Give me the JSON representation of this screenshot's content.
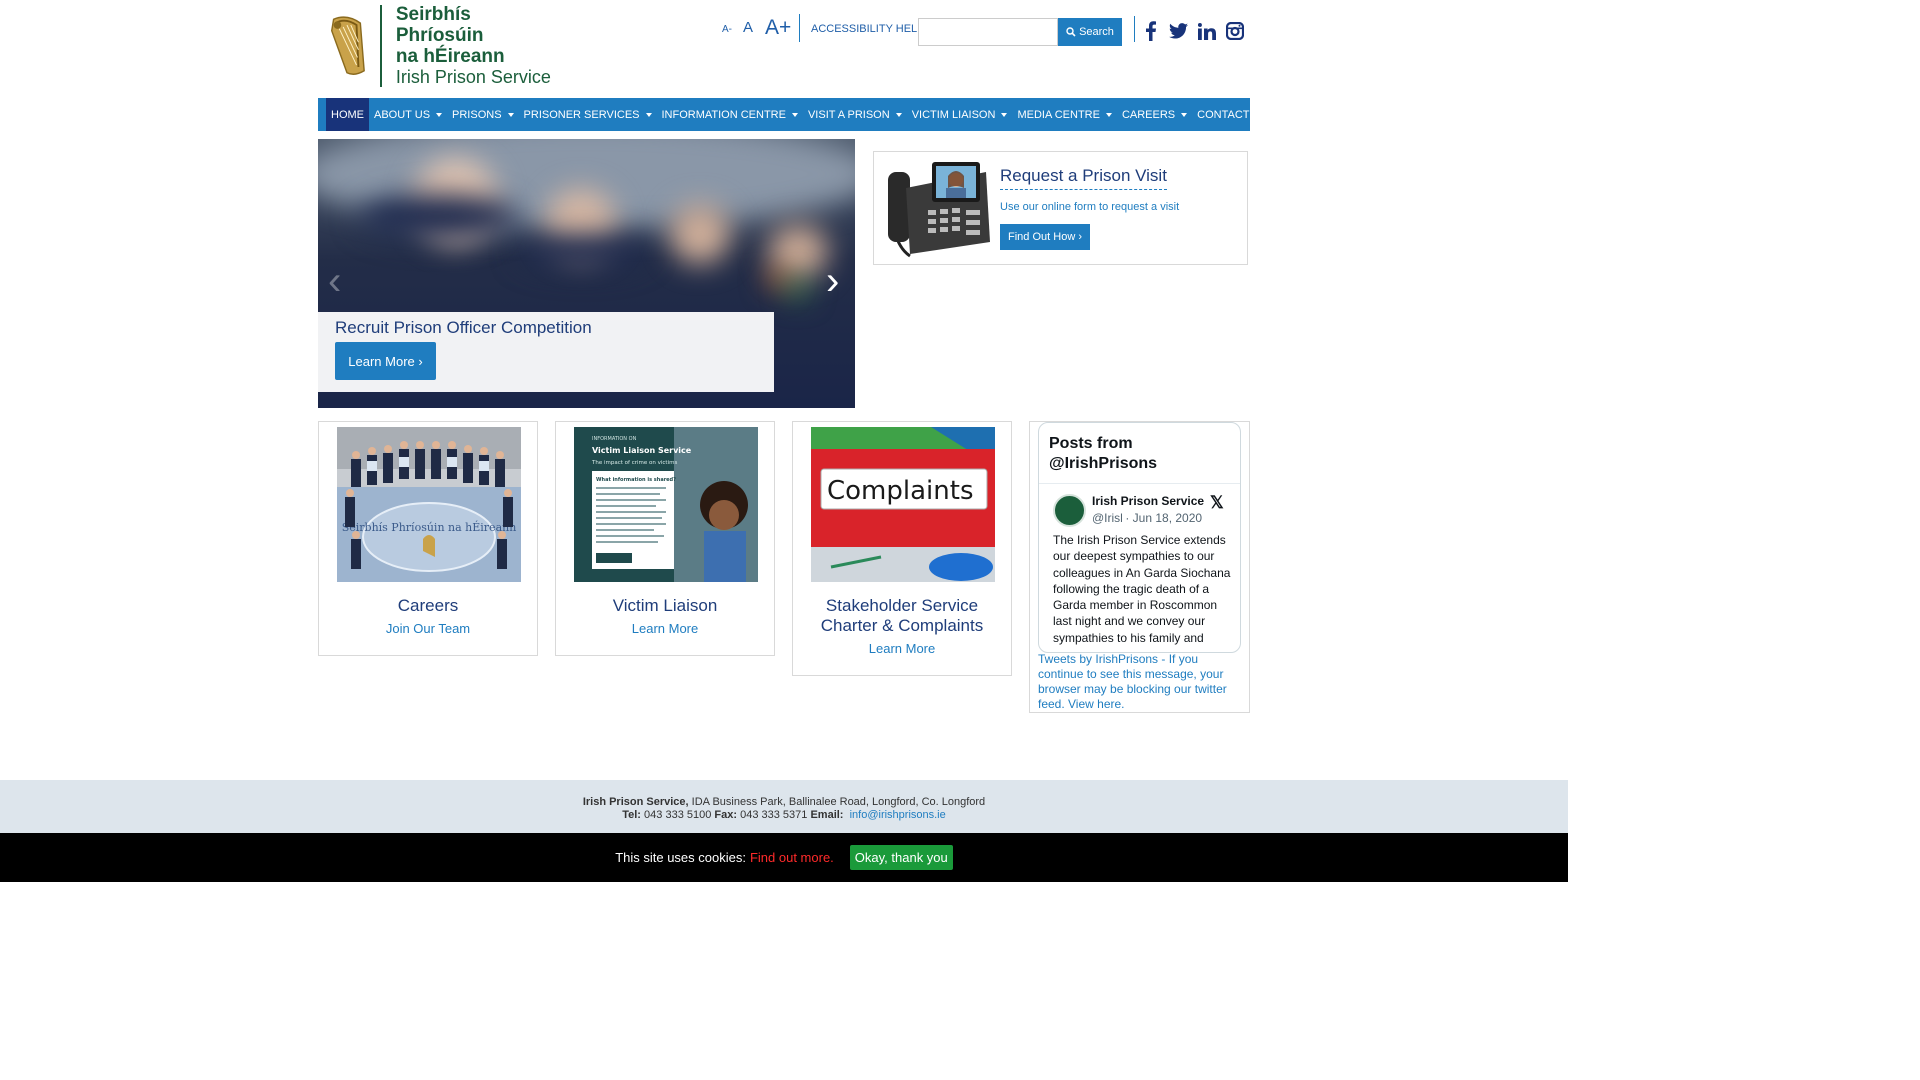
{
  "logo": {
    "line1": "Seirbhís Phríosúin",
    "line2": "na hÉireann",
    "line3": "Irish Prison Service"
  },
  "header": {
    "text_small": "A-",
    "text_medium": "A",
    "text_large": "A+",
    "accessibility_help": "ACCESSIBILITY HELP",
    "search_value": "",
    "search_button": "Search"
  },
  "nav": [
    {
      "label": "HOME",
      "active": true,
      "dropdown": false
    },
    {
      "label": "ABOUT US",
      "dropdown": true
    },
    {
      "label": "PRISONS",
      "dropdown": true
    },
    {
      "label": "PRISONER SERVICES",
      "dropdown": true
    },
    {
      "label": "INFORMATION CENTRE",
      "dropdown": true
    },
    {
      "label": "VISIT A PRISON",
      "dropdown": true
    },
    {
      "label": "VICTIM LIAISON",
      "dropdown": true
    },
    {
      "label": "MEDIA CENTRE",
      "dropdown": true
    },
    {
      "label": "CAREERS",
      "dropdown": true
    },
    {
      "label": "CONTACT",
      "dropdown": false
    }
  ],
  "carousel": {
    "title": "Recruit Prison Officer Competition",
    "button": "Learn More ›"
  },
  "visit": {
    "title": "Request a Prison Visit",
    "subtitle": "Use our online form to request a visit",
    "button": "Find Out How ›"
  },
  "cards": [
    {
      "title": "Careers",
      "link": "Join Our Team"
    },
    {
      "title": "Victim Liaison",
      "link": "Learn More"
    },
    {
      "title": "Stakeholder Service Charter & Complaints",
      "link": "Learn More"
    }
  ],
  "card_images": {
    "careers_seal_text": "Seirbhís Phríosúin na hÉireann",
    "victim_small": "INFORMATION ON",
    "victim_heading": "Victim Liaison Service",
    "victim_sub": "The impact of crime on victims",
    "victim_box_title": "What information is shared?",
    "complaints_label": "Complaints"
  },
  "twitter": {
    "heading": "Posts from @IrishPrisons",
    "account_name": "Irish Prison Service",
    "handle": "@IrishPrisons",
    "date": "· Jun 18, 2020",
    "tweet": "The Irish Prison Service extends our deepest sympathies to our colleagues in An Garda Siochana following the tragic death of a Garda member in Roscommon last night and we convey our sympathies to his family and",
    "footer": "Tweets by IrishPrisons - If you continue to see this message, your browser may be blocking our twitter feed. View here."
  },
  "footer": {
    "org": "Irish Prison Service,",
    "address": "IDA Business Park, Ballinalee Road, Longford, Co. Longford",
    "tel_label": "Tel:",
    "tel": "043 333 5100",
    "fax_label": "Fax:",
    "fax": "043 333 5371",
    "email_label": "Email:",
    "email": "info@irishprisons.ie"
  },
  "cookie": {
    "text": "This site uses cookies:",
    "link": "Find out more.",
    "button": "Okay, thank you"
  },
  "colors": {
    "nav_blue": "#1f7dc0",
    "nav_active": "#18337a",
    "title_navy": "#1f3d7a",
    "logo_green": "#1b5e3b",
    "cookie_green": "#1a9a3a"
  }
}
